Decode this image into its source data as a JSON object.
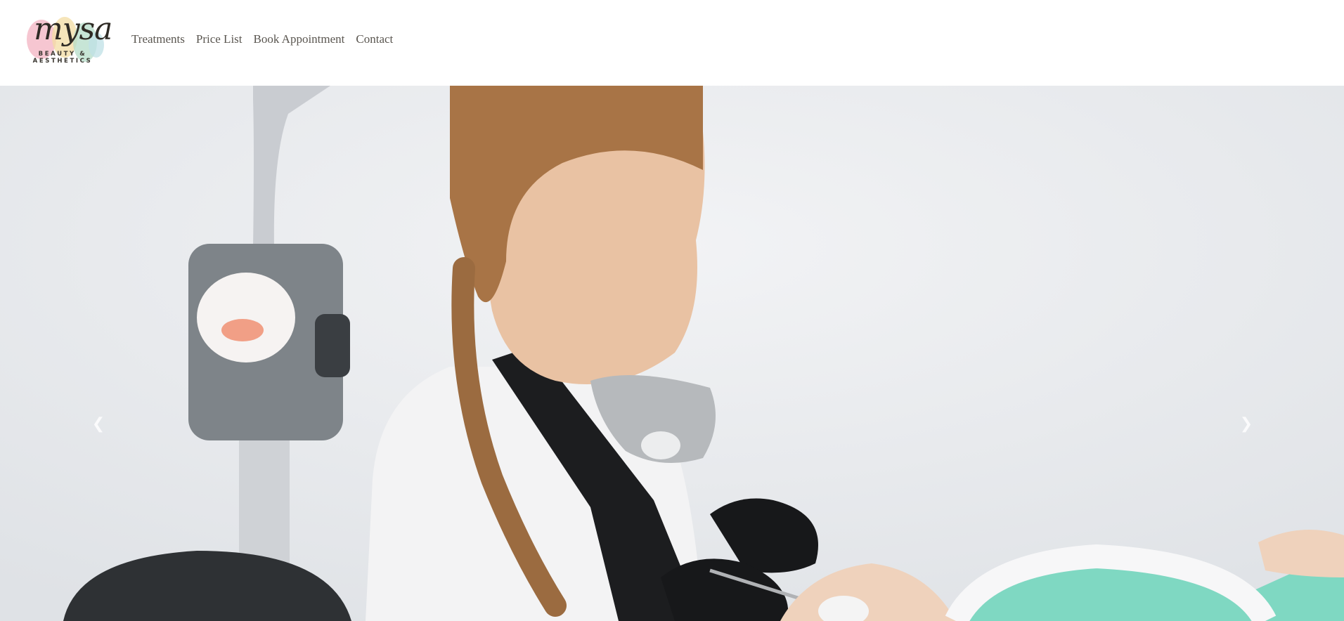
{
  "brand": {
    "logo_word": "mysa",
    "logo_tagline": "BEAUTY & AESTHETICS"
  },
  "nav": {
    "items": [
      {
        "label": "Treatments"
      },
      {
        "label": "Price List"
      },
      {
        "label": "Book Appointment"
      },
      {
        "label": "Contact"
      }
    ]
  },
  "hero": {
    "image": "Lash technician with braided hair, wearing a face mask, black apron and black gloves, applying eyelash extensions with tweezers to a reclining client beside a ring light",
    "prev_icon": "chevron-left-icon",
    "next_icon": "chevron-right-icon"
  },
  "colors": {
    "nav_text": "#5a5650",
    "header_bg": "#ffffff",
    "hero_bg": "#e9ebee"
  }
}
